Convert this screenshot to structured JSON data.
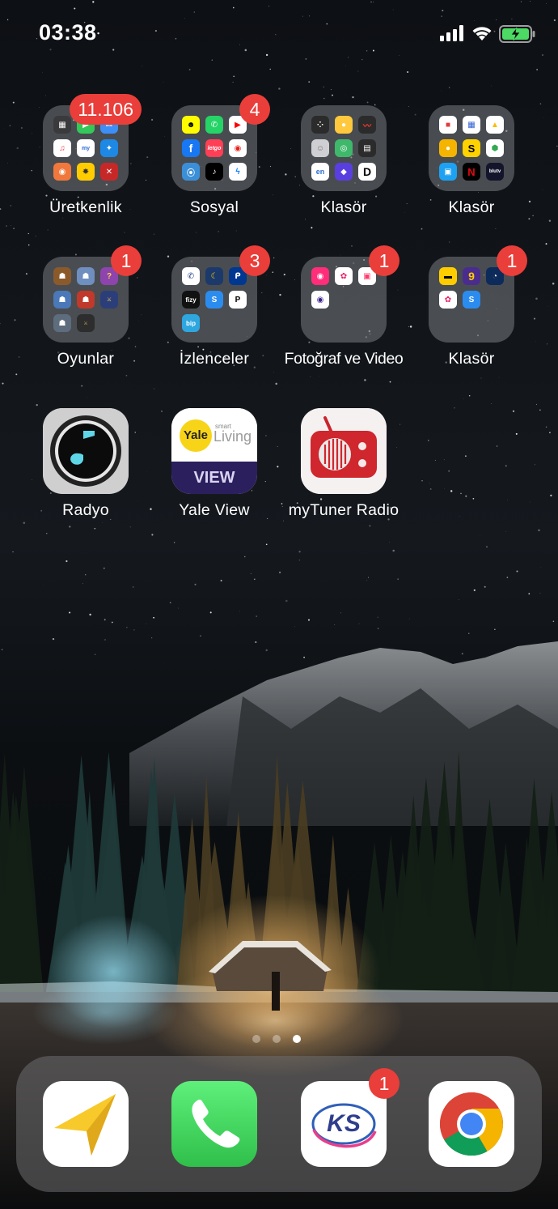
{
  "status_bar": {
    "time": "03:38",
    "signal_icon": "cellular-signal-icon",
    "wifi_icon": "wifi-icon",
    "battery_icon": "battery-charging-icon"
  },
  "home": {
    "row1": [
      {
        "label": "Üretkenlik",
        "badge": "11.106",
        "type": "folder"
      },
      {
        "label": "Sosyal",
        "badge": "4",
        "type": "folder"
      },
      {
        "label": "Klasör",
        "badge": "",
        "type": "folder"
      },
      {
        "label": "Klasör",
        "badge": "",
        "type": "folder"
      }
    ],
    "row2": [
      {
        "label": "Oyunlar",
        "badge": "1",
        "type": "folder"
      },
      {
        "label": "İzlenceler",
        "badge": "3",
        "type": "folder"
      },
      {
        "label": "Fotoğraf ve Video",
        "badge": "1",
        "type": "folder"
      },
      {
        "label": "Klasör",
        "badge": "1",
        "type": "folder"
      }
    ],
    "row3": [
      {
        "label": "Radyo",
        "type": "app"
      },
      {
        "label": "Yale View",
        "type": "app",
        "logo_text": "Yale",
        "logo_small": "smart",
        "logo_word": "Living",
        "banner": "VIEW"
      },
      {
        "label": "myTuner Radio",
        "type": "app"
      }
    ]
  },
  "mini_labels": {
    "letgo": "letgo",
    "fizy": "fizy",
    "bip": "bip",
    "en": "en",
    "blutv": "blutv",
    "s": "S",
    "nine": "9",
    "n": "N"
  },
  "page_indicator": {
    "pages": 3,
    "current": 3
  },
  "dock": [
    {
      "name": "navigation-app",
      "badge": ""
    },
    {
      "name": "phone-app",
      "badge": ""
    },
    {
      "name": "ks-app",
      "badge": "1",
      "logo_text": "KS"
    },
    {
      "name": "chrome-app",
      "badge": ""
    }
  ],
  "colors": {
    "badge": "#ea3e3a",
    "phone_green": "#34c759",
    "yale_purple": "#2c1f5e",
    "yale_yellow": "#f7d417",
    "mytuner_red": "#d0262d"
  }
}
